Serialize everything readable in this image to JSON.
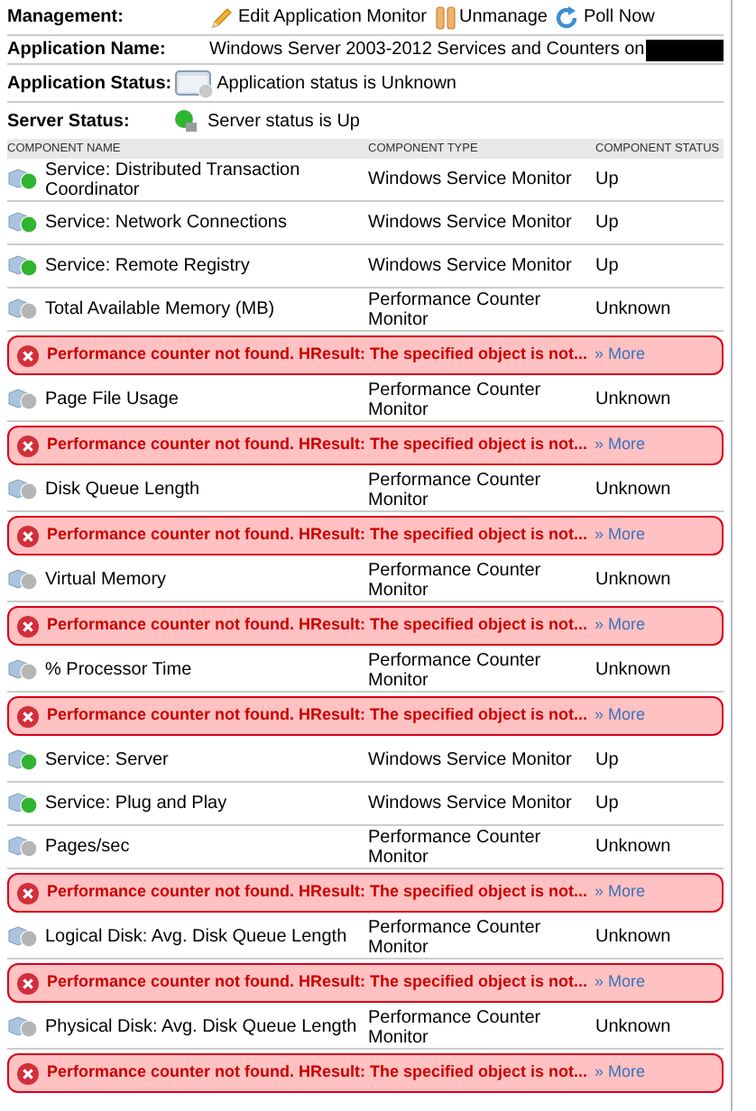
{
  "management": {
    "label": "Management:",
    "actions": [
      {
        "kind": "edit",
        "label": "Edit Application Monitor"
      },
      {
        "kind": "unmanage",
        "label": "Unmanage"
      },
      {
        "kind": "poll",
        "label": "Poll Now"
      }
    ]
  },
  "application_name": {
    "label": "Application Name:",
    "value": "Windows Server 2003-2012 Services and Counters on"
  },
  "application_status": {
    "label": "Application Status:",
    "up": false,
    "value": "Application status is Unknown"
  },
  "server_status": {
    "label": "Server Status:",
    "up": true,
    "value": "Server status is Up"
  },
  "table": {
    "columns": [
      "COMPONENT NAME",
      "COMPONENT TYPE",
      "COMPONENT STATUS"
    ],
    "rows": [
      {
        "name": "Service: Distributed Transaction Coordinator",
        "type": "Windows Service Monitor",
        "status": "Up",
        "up": true
      },
      {
        "name": "Service: Network Connections",
        "type": "Windows Service Monitor",
        "status": "Up",
        "up": true
      },
      {
        "name": "Service: Remote Registry",
        "type": "Windows Service Monitor",
        "status": "Up",
        "up": true
      },
      {
        "name": "Total Available Memory (MB)",
        "type": "Performance Counter Monitor",
        "status": "Unknown",
        "up": false,
        "error": {
          "message": "Performance counter not found. HResult: The specified object is not...",
          "link": "» More"
        }
      },
      {
        "name": "Page File Usage",
        "type": "Performance Counter Monitor",
        "status": "Unknown",
        "up": false,
        "error": {
          "message": "Performance counter not found. HResult: The specified object is not...",
          "link": "» More"
        }
      },
      {
        "name": "Disk Queue Length",
        "type": "Performance Counter Monitor",
        "status": "Unknown",
        "up": false,
        "error": {
          "message": "Performance counter not found. HResult: The specified object is not...",
          "link": "» More"
        }
      },
      {
        "name": "Virtual Memory",
        "type": "Performance Counter Monitor",
        "status": "Unknown",
        "up": false,
        "error": {
          "message": "Performance counter not found. HResult: The specified object is not...",
          "link": "» More"
        }
      },
      {
        "name": "% Processor Time",
        "type": "Performance Counter Monitor",
        "status": "Unknown",
        "up": false,
        "error": {
          "message": "Performance counter not found. HResult: The specified object is not...",
          "link": "» More"
        }
      },
      {
        "name": "Service: Server",
        "type": "Windows Service Monitor",
        "status": "Up",
        "up": true
      },
      {
        "name": "Service: Plug and Play",
        "type": "Windows Service Monitor",
        "status": "Up",
        "up": true
      },
      {
        "name": "Pages/sec",
        "type": "Performance Counter Monitor",
        "status": "Unknown",
        "up": false,
        "error": {
          "message": "Performance counter not found. HResult: The specified object is not...",
          "link": "» More"
        }
      },
      {
        "name": "Logical Disk: Avg. Disk Queue Length",
        "type": "Performance Counter Monitor",
        "status": "Unknown",
        "up": false,
        "error": {
          "message": "Performance counter not found. HResult: The specified object is not...",
          "link": "» More"
        }
      },
      {
        "name": "Physical Disk: Avg. Disk Queue Length",
        "type": "Performance Counter Monitor",
        "status": "Unknown",
        "up": false,
        "error": {
          "message": "Performance counter not found. HResult: The specified object is not...",
          "link": "» More"
        }
      }
    ]
  }
}
